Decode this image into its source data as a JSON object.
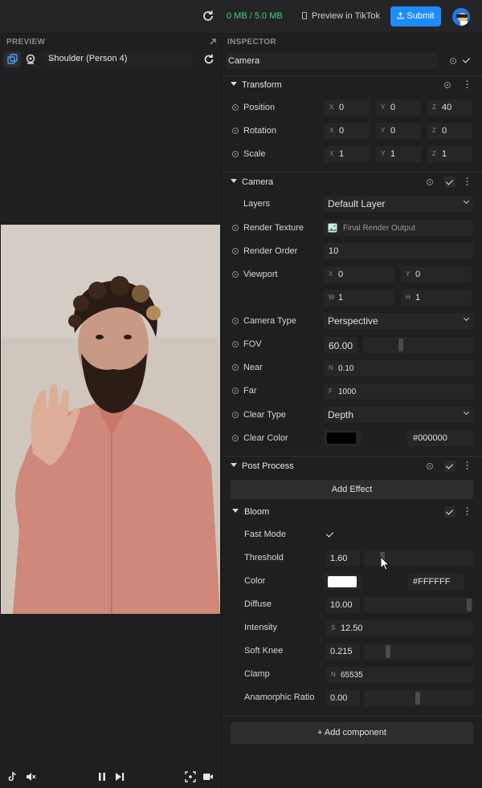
{
  "topbar": {
    "memory": "0 MB / 5.0 MB",
    "preview_label": "Preview in TikTok",
    "submit_label": "Submit",
    "accent": "#1e8bff",
    "memory_color": "#41d07a"
  },
  "preview": {
    "title": "PREVIEW",
    "tracker_select": "Shoulder (Person 4)"
  },
  "inspector": {
    "title": "INSPECTOR",
    "object_name": "Camera",
    "transform": {
      "title": "Transform",
      "position": {
        "label": "Position",
        "x": "0",
        "y": "0",
        "z": "40"
      },
      "rotation": {
        "label": "Rotation",
        "x": "0",
        "y": "0",
        "z": "0"
      },
      "scale": {
        "label": "Scale",
        "x": "1",
        "y": "1",
        "z": "1"
      }
    },
    "camera": {
      "title": "Camera",
      "layers_label": "Layers",
      "layers_value": "Default Layer",
      "render_texture_label": "Render Texture",
      "render_texture_value": "Final Render Output",
      "render_order_label": "Render Order",
      "render_order_value": "10",
      "viewport_label": "Viewport",
      "viewport_x": "0",
      "viewport_y": "0",
      "viewport_w": "1",
      "viewport_h": "1",
      "camera_type_label": "Camera Type",
      "camera_type_value": "Perspective",
      "fov_label": "FOV",
      "fov_value": "60.00",
      "near_label": "Near",
      "near_value": "0.10",
      "far_label": "Far",
      "far_value": "1000",
      "clear_type_label": "Clear Type",
      "clear_type_value": "Depth",
      "clear_color_label": "Clear Color",
      "clear_color_hex": "#000000"
    },
    "post_process": {
      "title": "Post Process",
      "add_effect": "Add Effect",
      "bloom": {
        "title": "Bloom",
        "fast_mode_label": "Fast Mode",
        "threshold_label": "Threshold",
        "threshold_value": "1.60",
        "color_label": "Color",
        "color_hex": "#FFFFFF",
        "diffuse_label": "Diffuse",
        "diffuse_value": "10.00",
        "intensity_label": "Intensity",
        "intensity_value": "12.50",
        "soft_knee_label": "Soft Knee",
        "soft_knee_value": "0.215",
        "clamp_label": "Clamp",
        "clamp_value": "65535",
        "anamorphic_label": "Anamorphic Ratio",
        "anamorphic_value": "0.00"
      }
    },
    "add_component": "+ Add component"
  }
}
